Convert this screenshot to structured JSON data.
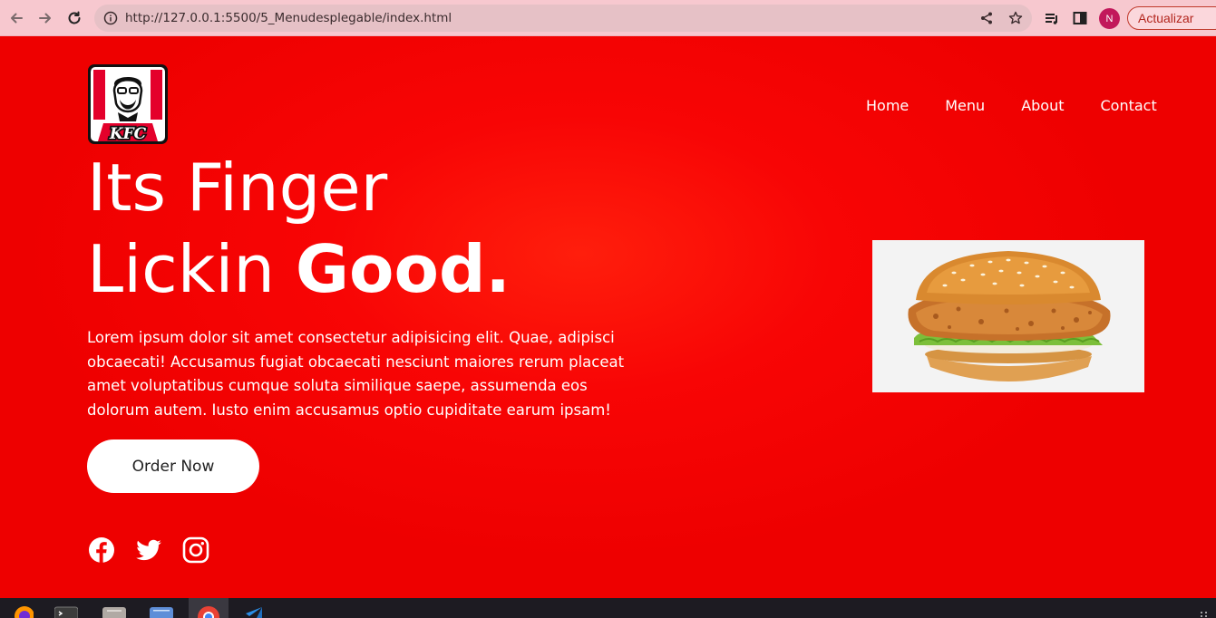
{
  "browser": {
    "url": "http://127.0.0.1:5500/5_Menudesplegable/index.html",
    "profile_initial": "N",
    "update_label": "Actualizar",
    "icons": [
      "back-arrow-icon",
      "forward-arrow-icon",
      "reload-icon",
      "info-icon",
      "share-icon",
      "star-icon",
      "reading-list-icon",
      "side-panel-icon",
      "kebab-menu-icon"
    ]
  },
  "header": {
    "logo_text": "KFC",
    "nav": [
      "Home",
      "Menu",
      "About",
      "Contact"
    ]
  },
  "hero": {
    "title_line1": "Its Finger",
    "title_line2_light": "Lickin ",
    "title_line2_bold": "Good.",
    "paragraph": "Lorem ipsum dolor sit amet consectetur adipisicing elit. Quae, adipisci obcaecati! Accusamus fugiat obcaecati nesciunt maiores rerum placeat amet voluptatibus cumque soluta similique saepe, assumenda eos dolorum autem. Iusto enim accusamus optio cupiditate earum ipsam!",
    "cta_label": "Order Now"
  },
  "socials": [
    "facebook-icon",
    "twitter-icon",
    "instagram-icon"
  ],
  "colors": {
    "background": "#f50505",
    "chrome": "#f7c8cf",
    "text": "#ffffff"
  }
}
